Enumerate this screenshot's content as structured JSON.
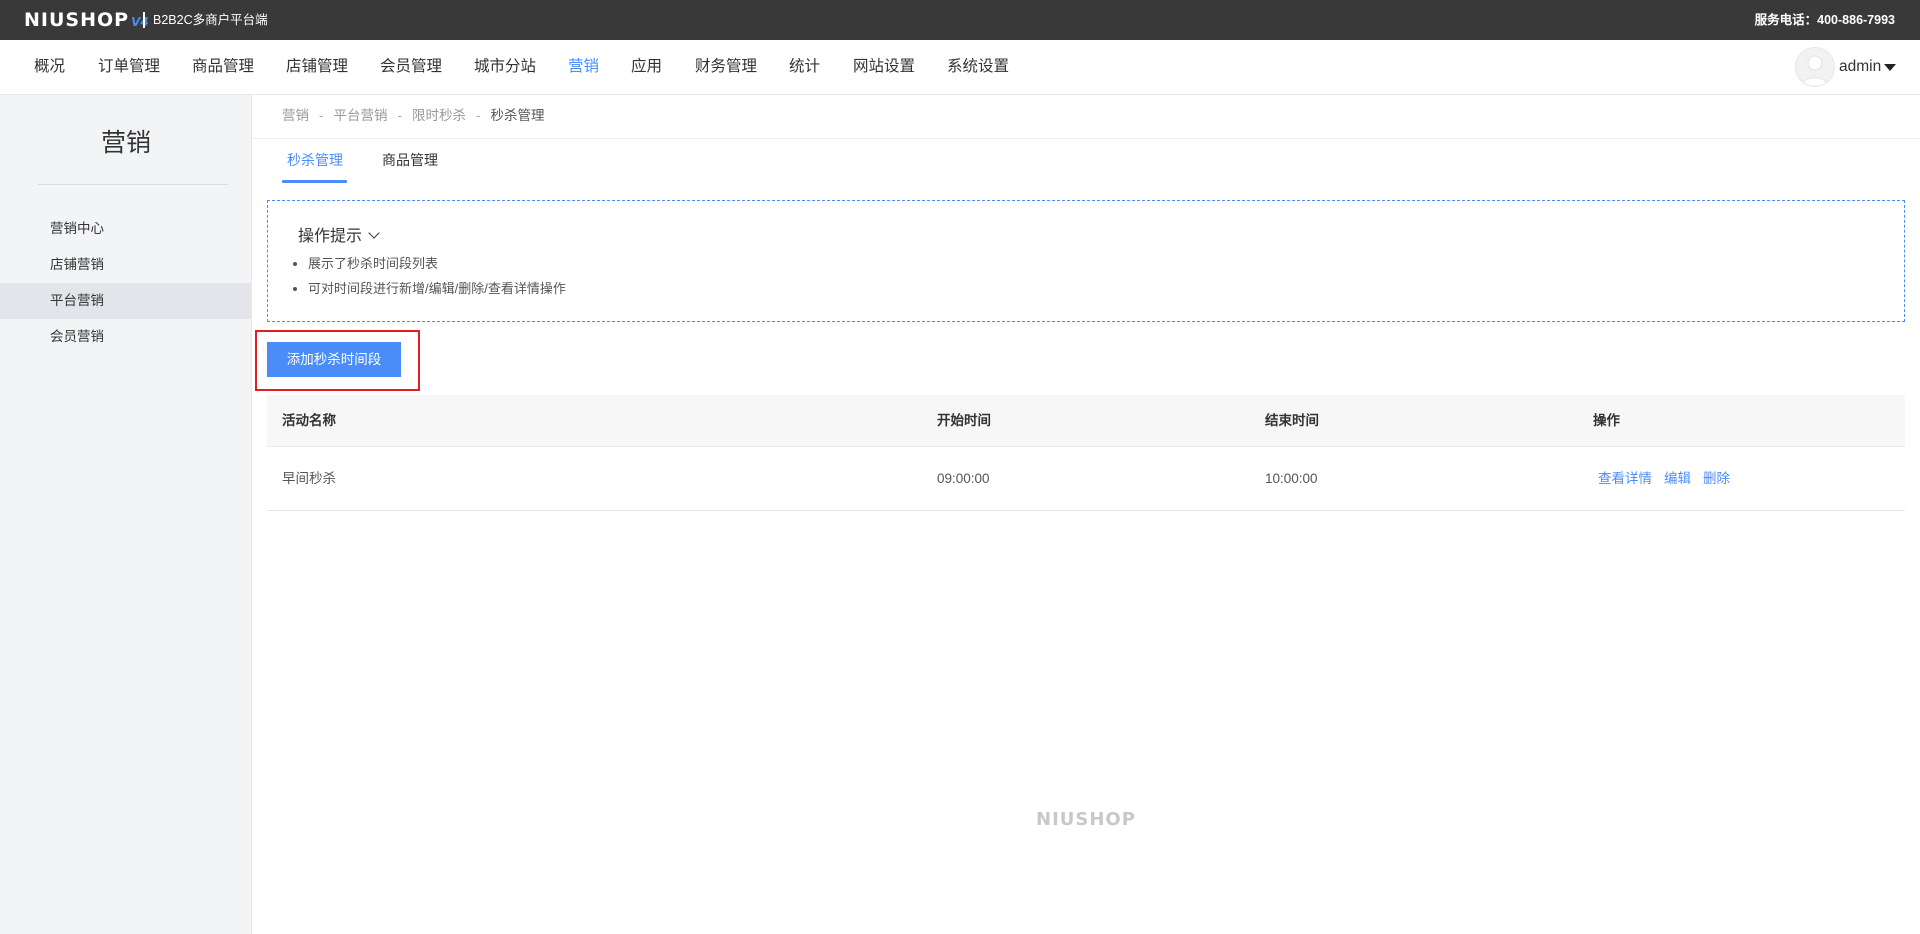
{
  "topbar": {
    "logo_text": "NIUSHOP",
    "logo_version": "V4",
    "platform_name": "B2B2C多商户平台端",
    "service_phone": "服务电话：400-886-7993"
  },
  "mainnav": {
    "items": [
      "概况",
      "订单管理",
      "商品管理",
      "店铺管理",
      "会员管理",
      "城市分站",
      "营销",
      "应用",
      "财务管理",
      "统计",
      "网站设置",
      "系统设置"
    ],
    "active": "营销",
    "user_name": "admin"
  },
  "sidebar": {
    "title": "营销",
    "items": [
      "营销中心",
      "店铺营销",
      "平台营销",
      "会员营销"
    ],
    "active": "平台营销"
  },
  "breadcrumb": {
    "items": [
      "营销",
      "平台营销",
      "限时秒杀",
      "秒杀管理"
    ],
    "separator": "-"
  },
  "tabs": {
    "items": [
      "秒杀管理",
      "商品管理"
    ],
    "active": "秒杀管理"
  },
  "tips": {
    "title": "操作提示",
    "lines": [
      "展示了秒杀时间段列表",
      "可对时间段进行新增/编辑/删除/查看详情操作"
    ]
  },
  "actions": {
    "add_label": "添加秒杀时间段"
  },
  "table": {
    "headers": [
      "活动名称",
      "开始时间",
      "结束时间",
      "操作"
    ],
    "rows": [
      {
        "name": "早间秒杀",
        "start": "09:00:00",
        "end": "10:00:00",
        "ops": [
          "查看详情",
          "编辑",
          "删除"
        ]
      }
    ]
  },
  "footer": {
    "logo_text": "NIUSHOP"
  },
  "colors": {
    "accent": "#4a8df8",
    "topbar_bg": "#393939",
    "highlight": "#e02020"
  }
}
